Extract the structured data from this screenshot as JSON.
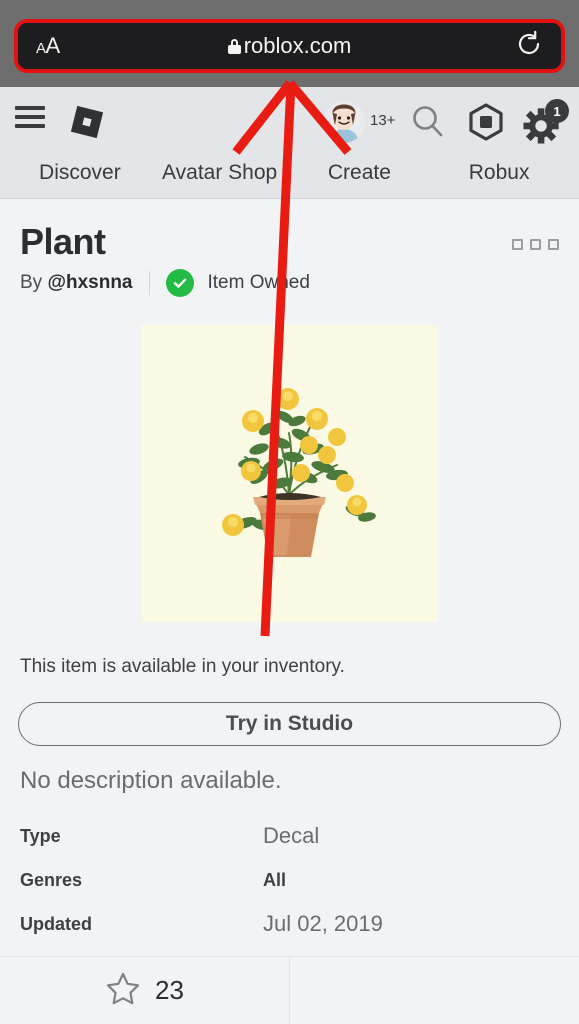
{
  "browser": {
    "text_size_small": "A",
    "text_size_large": "A",
    "url": "roblox.com",
    "lock_icon": "lock-icon",
    "reload_icon": "reload-icon",
    "highlight_color": "#e21212",
    "bar_color": "#1d1d1f",
    "chrome_color": "#6e6e6e"
  },
  "header": {
    "menu_icon": "hamburger-menu-icon",
    "logo_icon": "roblox-logo-icon",
    "avatar_icon": "user-avatar",
    "age_badge": "13+",
    "search_icon": "search-icon",
    "robux_icon": "robux-icon",
    "gear_icon": "gear-icon",
    "notification_count": "1",
    "tabs": [
      {
        "label": "Discover"
      },
      {
        "label": "Avatar Shop"
      },
      {
        "label": "Create"
      },
      {
        "label": "Robux"
      }
    ]
  },
  "item": {
    "title": "Plant",
    "overflow_menu": "overflow-menu-icon",
    "by_prefix": "By ",
    "creator": "@hxsnna",
    "owned_check": "check-icon",
    "owned_label": "Item Owned",
    "image_alt": "potted-plant-with-yellow-flowers",
    "image_bg": "#fafae4",
    "inventory_note": "This item is available in your inventory.",
    "action_button": "Try in Studio",
    "description": "No description available.",
    "details": [
      {
        "label": "Type",
        "value": "Decal",
        "style": "light"
      },
      {
        "label": "Genres",
        "value": "All",
        "style": "bold"
      },
      {
        "label": "Updated",
        "value": "Jul 02, 2019",
        "style": "light"
      }
    ]
  },
  "bottom_bar": {
    "favorite_icon": "star-outline-icon",
    "favorite_count": "23"
  },
  "annotation": {
    "arrow_color": "#e81c12",
    "description": "red-arrow-pointing-to-url-bar"
  }
}
